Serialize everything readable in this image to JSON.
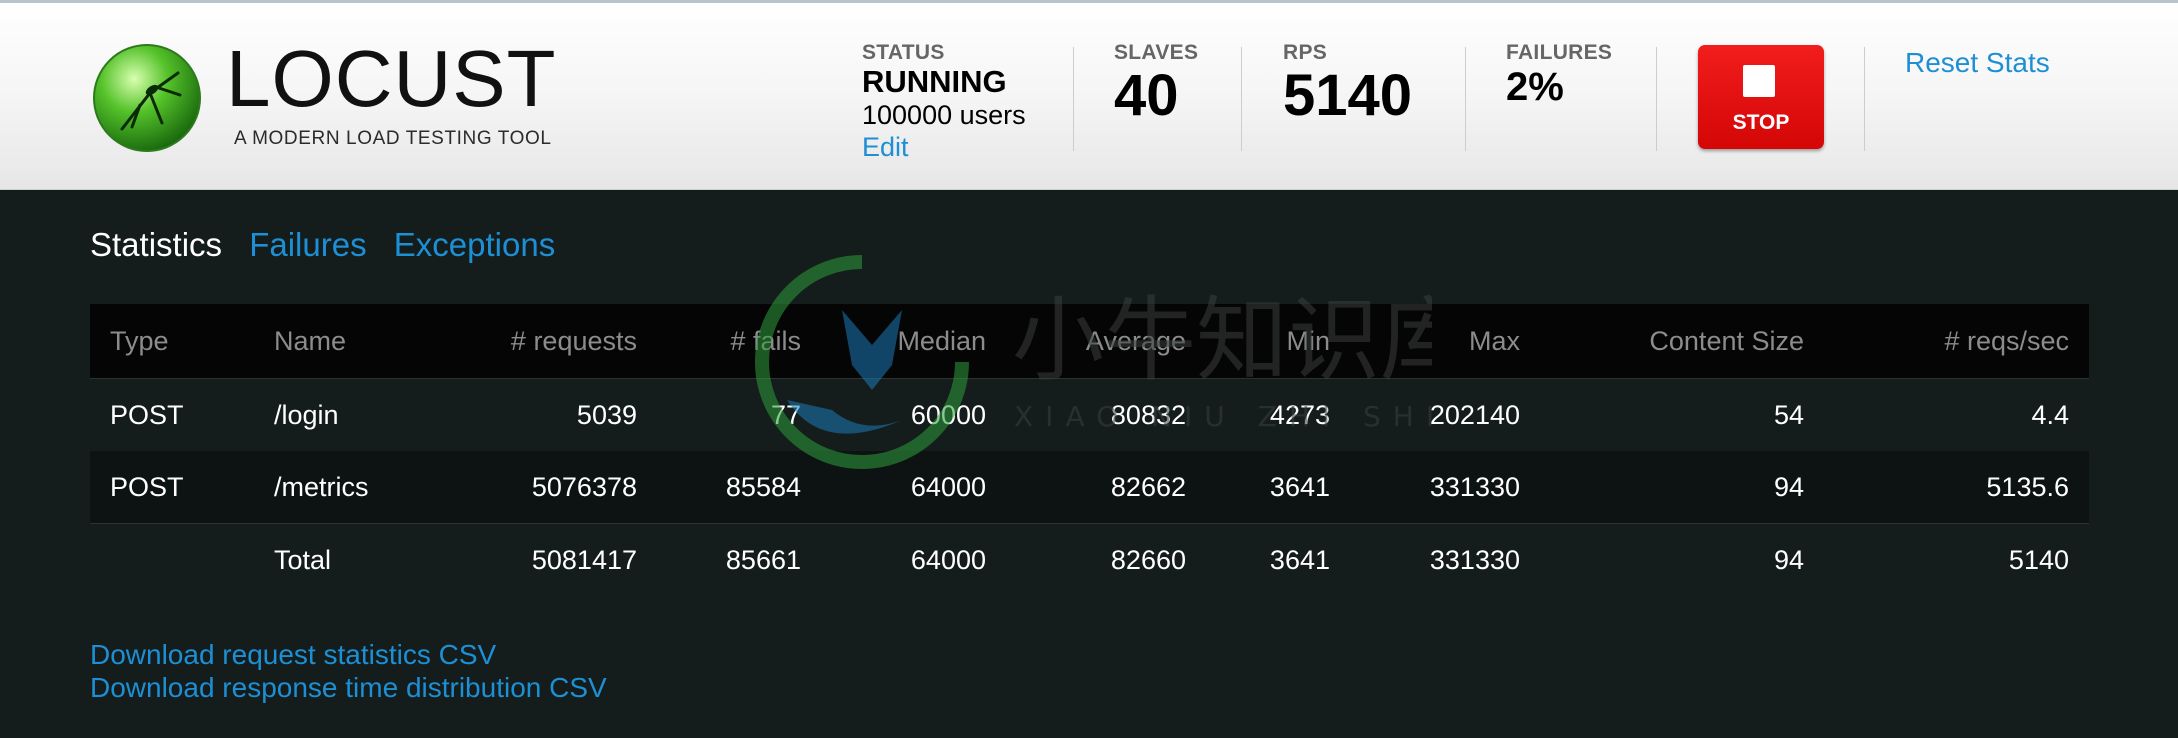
{
  "header": {
    "logo_text": "LOCUST",
    "logo_tagline": "A MODERN LOAD TESTING TOOL",
    "status": {
      "label": "STATUS",
      "value": "RUNNING",
      "users": "100000 users",
      "edit_label": "Edit"
    },
    "slaves": {
      "label": "SLAVES",
      "value": "40"
    },
    "rps": {
      "label": "RPS",
      "value": "5140"
    },
    "failures": {
      "label": "FAILURES",
      "value": "2%"
    },
    "stop_label": "STOP",
    "reset_label": "Reset Stats"
  },
  "tabs": [
    {
      "label": "Statistics",
      "active": true
    },
    {
      "label": "Failures",
      "active": false
    },
    {
      "label": "Exceptions",
      "active": false
    }
  ],
  "table": {
    "columns": [
      "Type",
      "Name",
      "# requests",
      "# fails",
      "Median",
      "Average",
      "Min",
      "Max",
      "Content Size",
      "# reqs/sec"
    ],
    "rows": [
      [
        "POST",
        "/login",
        "5039",
        "77",
        "60000",
        "80832",
        "4273",
        "202140",
        "54",
        "4.4"
      ],
      [
        "POST",
        "/metrics",
        "5076378",
        "85584",
        "64000",
        "82662",
        "3641",
        "331330",
        "94",
        "5135.6"
      ]
    ],
    "total": [
      "",
      "Total",
      "5081417",
      "85661",
      "64000",
      "82660",
      "3641",
      "331330",
      "94",
      "5140"
    ]
  },
  "downloads": {
    "request_stats": "Download request statistics CSV",
    "response_times": "Download response time distribution CSV"
  },
  "watermark": {
    "text": "小牛知识库",
    "subtext": "XIAO NIU ZHI SHI KU"
  },
  "colors": {
    "link": "#1d8fd4",
    "stop_button": "#e01010",
    "page_background": "#141c1c",
    "table_header": "#050505"
  },
  "icons": {
    "logo": "locust-logo-icon",
    "stop": "stop-square-icon"
  }
}
